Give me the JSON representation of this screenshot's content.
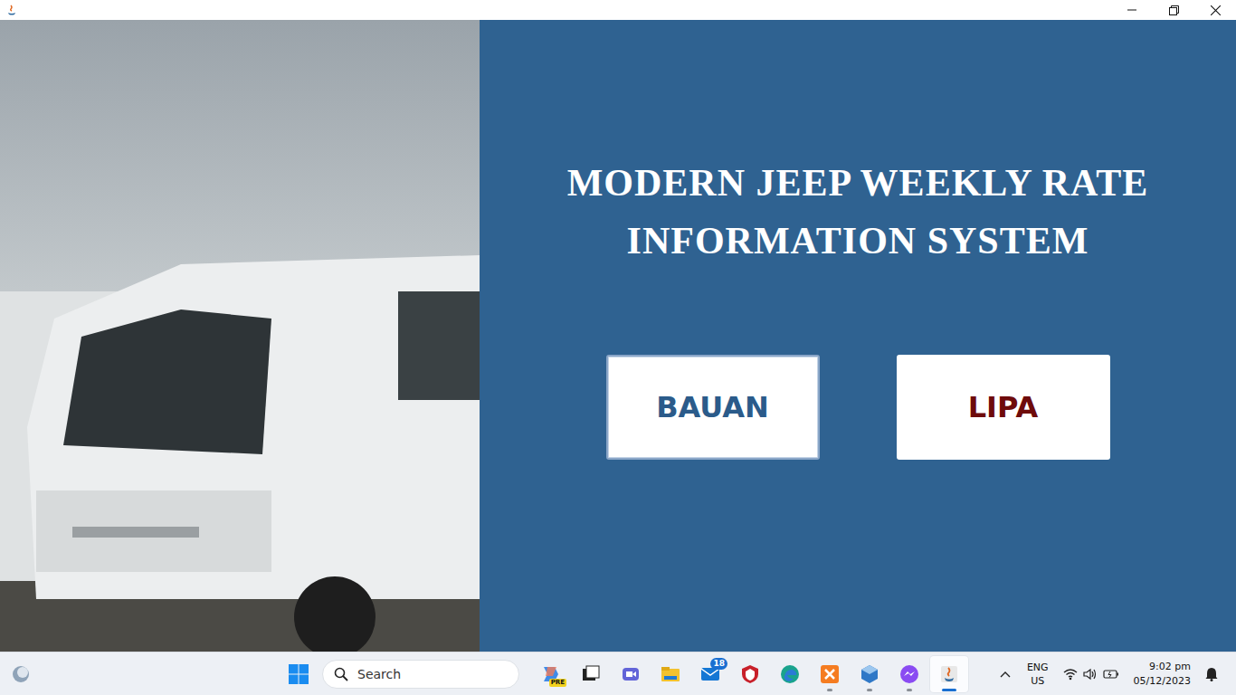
{
  "window": {
    "maximized": true
  },
  "header": {
    "title_lines": [
      "MODERN JEEP WEEKLY RATE",
      "INFORMATION SYSTEM"
    ]
  },
  "branches": [
    {
      "label": "BAUAN",
      "color": "#2b5b8a",
      "focused": true
    },
    {
      "label": "LIPA",
      "color": "#6e0b0b",
      "focused": false
    }
  ],
  "taskbar": {
    "search": {
      "placeholder": "Search"
    },
    "apps": [
      {
        "kind": "copilot",
        "badge": "PRE",
        "running": false,
        "active": false
      },
      {
        "kind": "taskview",
        "running": false,
        "active": false
      },
      {
        "kind": "teams",
        "running": false,
        "active": false
      },
      {
        "kind": "explorer",
        "running": false,
        "active": false
      },
      {
        "kind": "mail",
        "badge": "18",
        "running": false,
        "active": false
      },
      {
        "kind": "shield",
        "running": false,
        "active": false
      },
      {
        "kind": "edge",
        "running": false,
        "active": false
      },
      {
        "kind": "xampp",
        "running": true,
        "active": false
      },
      {
        "kind": "virtualbox",
        "running": true,
        "active": false
      },
      {
        "kind": "messenger",
        "running": true,
        "active": false
      },
      {
        "kind": "java",
        "running": true,
        "active": true
      }
    ],
    "tray": {
      "lang": [
        "ENG",
        "US"
      ],
      "time": "9:02 pm",
      "date": "05/12/2023"
    }
  }
}
